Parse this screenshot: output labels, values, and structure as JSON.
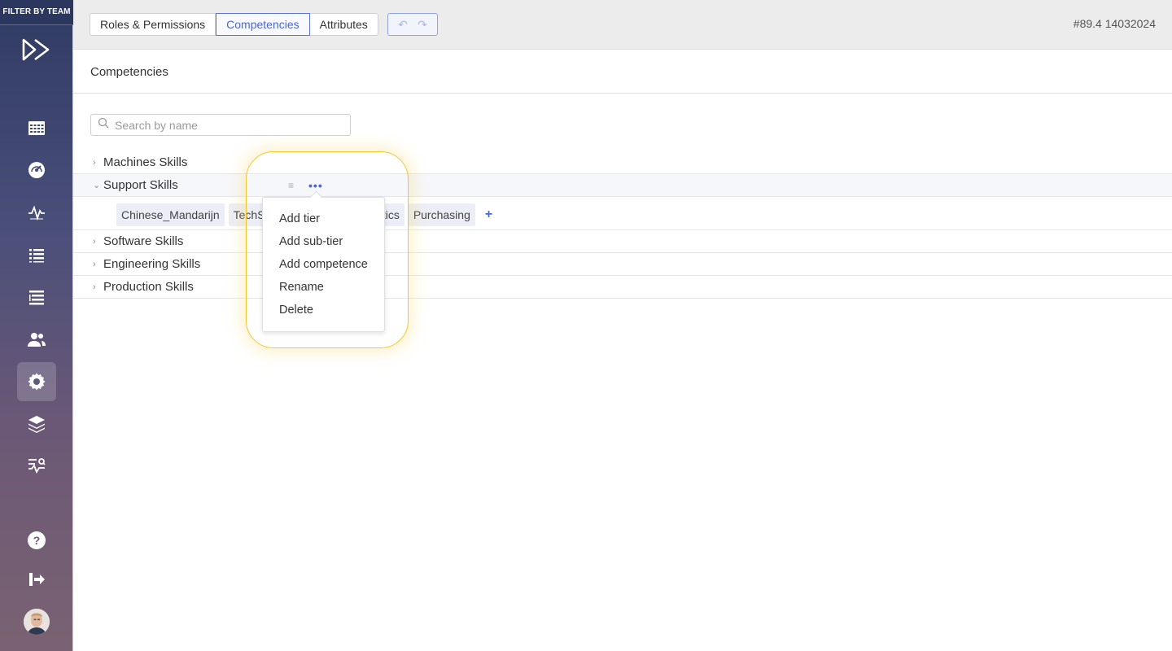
{
  "sidebar": {
    "filter_label": "FILTER BY TEAM",
    "logo_icon": "fast-forward-logo",
    "nav_items": [
      {
        "name": "calendar-grid-icon"
      },
      {
        "name": "dashboard-gauge-icon"
      },
      {
        "name": "activity-pulse-icon"
      },
      {
        "name": "list-icon"
      },
      {
        "name": "tree-list-icon"
      },
      {
        "name": "users-icon"
      },
      {
        "name": "settings-gear-icon",
        "active": true
      },
      {
        "name": "layers-icon"
      },
      {
        "name": "analytics-search-icon"
      },
      {
        "name": "help-icon"
      },
      {
        "name": "logout-icon"
      }
    ]
  },
  "topbar": {
    "tabs": [
      {
        "label": "Roles & Permissions"
      },
      {
        "label": "Competencies",
        "active": true
      },
      {
        "label": "Attributes"
      }
    ],
    "undo_icon": "undo-icon",
    "redo_icon": "redo-icon",
    "version": "#89.4 14032024"
  },
  "page": {
    "title": "Competencies",
    "search_placeholder": "Search by name"
  },
  "tree": {
    "rows": [
      {
        "label": "Machines Skills",
        "expanded": false
      },
      {
        "label": "Support Skills",
        "expanded": true,
        "chips": [
          "Chinese_Mandarijn",
          "TechSu",
          "Logistics",
          "Purchasing"
        ]
      },
      {
        "label": "Software Skills",
        "expanded": false
      },
      {
        "label": "Engineering Skills",
        "expanded": false
      },
      {
        "label": "Production Skills",
        "expanded": false
      }
    ]
  },
  "context_menu": {
    "items": [
      "Add tier",
      "Add sub-tier",
      "Add competence",
      "Rename",
      "Delete"
    ]
  },
  "colors": {
    "accent": "#4a67d6",
    "highlight": "#f5c52c"
  }
}
